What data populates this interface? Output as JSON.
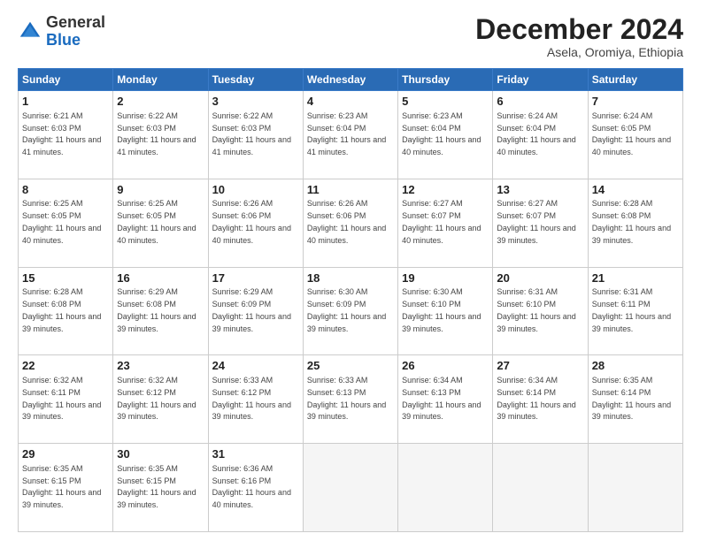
{
  "header": {
    "logo_general": "General",
    "logo_blue": "Blue",
    "month_title": "December 2024",
    "subtitle": "Asela, Oromiya, Ethiopia"
  },
  "days_of_week": [
    "Sunday",
    "Monday",
    "Tuesday",
    "Wednesday",
    "Thursday",
    "Friday",
    "Saturday"
  ],
  "weeks": [
    [
      {
        "day": "1",
        "sunrise": "6:21 AM",
        "sunset": "6:03 PM",
        "daylight": "11 hours and 41 minutes."
      },
      {
        "day": "2",
        "sunrise": "6:22 AM",
        "sunset": "6:03 PM",
        "daylight": "11 hours and 41 minutes."
      },
      {
        "day": "3",
        "sunrise": "6:22 AM",
        "sunset": "6:03 PM",
        "daylight": "11 hours and 41 minutes."
      },
      {
        "day": "4",
        "sunrise": "6:23 AM",
        "sunset": "6:04 PM",
        "daylight": "11 hours and 41 minutes."
      },
      {
        "day": "5",
        "sunrise": "6:23 AM",
        "sunset": "6:04 PM",
        "daylight": "11 hours and 40 minutes."
      },
      {
        "day": "6",
        "sunrise": "6:24 AM",
        "sunset": "6:04 PM",
        "daylight": "11 hours and 40 minutes."
      },
      {
        "day": "7",
        "sunrise": "6:24 AM",
        "sunset": "6:05 PM",
        "daylight": "11 hours and 40 minutes."
      }
    ],
    [
      {
        "day": "8",
        "sunrise": "6:25 AM",
        "sunset": "6:05 PM",
        "daylight": "11 hours and 40 minutes."
      },
      {
        "day": "9",
        "sunrise": "6:25 AM",
        "sunset": "6:05 PM",
        "daylight": "11 hours and 40 minutes."
      },
      {
        "day": "10",
        "sunrise": "6:26 AM",
        "sunset": "6:06 PM",
        "daylight": "11 hours and 40 minutes."
      },
      {
        "day": "11",
        "sunrise": "6:26 AM",
        "sunset": "6:06 PM",
        "daylight": "11 hours and 40 minutes."
      },
      {
        "day": "12",
        "sunrise": "6:27 AM",
        "sunset": "6:07 PM",
        "daylight": "11 hours and 40 minutes."
      },
      {
        "day": "13",
        "sunrise": "6:27 AM",
        "sunset": "6:07 PM",
        "daylight": "11 hours and 39 minutes."
      },
      {
        "day": "14",
        "sunrise": "6:28 AM",
        "sunset": "6:08 PM",
        "daylight": "11 hours and 39 minutes."
      }
    ],
    [
      {
        "day": "15",
        "sunrise": "6:28 AM",
        "sunset": "6:08 PM",
        "daylight": "11 hours and 39 minutes."
      },
      {
        "day": "16",
        "sunrise": "6:29 AM",
        "sunset": "6:08 PM",
        "daylight": "11 hours and 39 minutes."
      },
      {
        "day": "17",
        "sunrise": "6:29 AM",
        "sunset": "6:09 PM",
        "daylight": "11 hours and 39 minutes."
      },
      {
        "day": "18",
        "sunrise": "6:30 AM",
        "sunset": "6:09 PM",
        "daylight": "11 hours and 39 minutes."
      },
      {
        "day": "19",
        "sunrise": "6:30 AM",
        "sunset": "6:10 PM",
        "daylight": "11 hours and 39 minutes."
      },
      {
        "day": "20",
        "sunrise": "6:31 AM",
        "sunset": "6:10 PM",
        "daylight": "11 hours and 39 minutes."
      },
      {
        "day": "21",
        "sunrise": "6:31 AM",
        "sunset": "6:11 PM",
        "daylight": "11 hours and 39 minutes."
      }
    ],
    [
      {
        "day": "22",
        "sunrise": "6:32 AM",
        "sunset": "6:11 PM",
        "daylight": "11 hours and 39 minutes."
      },
      {
        "day": "23",
        "sunrise": "6:32 AM",
        "sunset": "6:12 PM",
        "daylight": "11 hours and 39 minutes."
      },
      {
        "day": "24",
        "sunrise": "6:33 AM",
        "sunset": "6:12 PM",
        "daylight": "11 hours and 39 minutes."
      },
      {
        "day": "25",
        "sunrise": "6:33 AM",
        "sunset": "6:13 PM",
        "daylight": "11 hours and 39 minutes."
      },
      {
        "day": "26",
        "sunrise": "6:34 AM",
        "sunset": "6:13 PM",
        "daylight": "11 hours and 39 minutes."
      },
      {
        "day": "27",
        "sunrise": "6:34 AM",
        "sunset": "6:14 PM",
        "daylight": "11 hours and 39 minutes."
      },
      {
        "day": "28",
        "sunrise": "6:35 AM",
        "sunset": "6:14 PM",
        "daylight": "11 hours and 39 minutes."
      }
    ],
    [
      {
        "day": "29",
        "sunrise": "6:35 AM",
        "sunset": "6:15 PM",
        "daylight": "11 hours and 39 minutes."
      },
      {
        "day": "30",
        "sunrise": "6:35 AM",
        "sunset": "6:15 PM",
        "daylight": "11 hours and 39 minutes."
      },
      {
        "day": "31",
        "sunrise": "6:36 AM",
        "sunset": "6:16 PM",
        "daylight": "11 hours and 40 minutes."
      },
      null,
      null,
      null,
      null
    ]
  ]
}
